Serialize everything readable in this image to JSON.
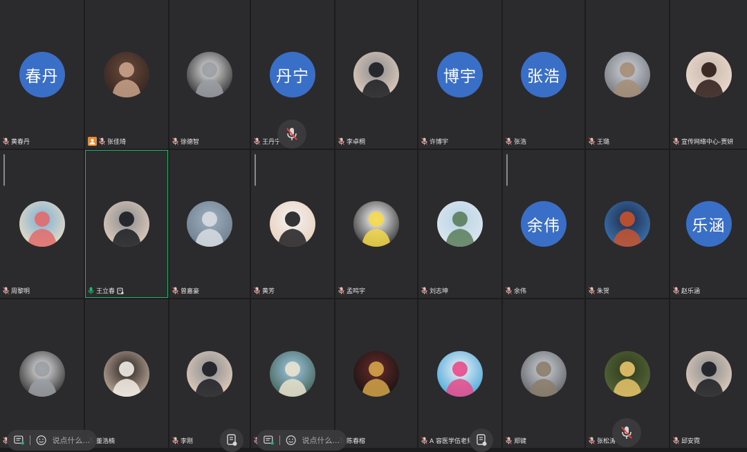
{
  "colors": {
    "tile_bg": "#2b2b2d",
    "avatar_blue": "#3a6fc8",
    "active_border": "#23b26d",
    "host_badge": "#f08a24"
  },
  "participants": [
    {
      "name": "黄春丹",
      "avatar_text": "春丹",
      "avatar_type": "text",
      "mic": "muted"
    },
    {
      "name": "张佳琦",
      "avatar_type": "photo",
      "photo_hint": "girl-portrait",
      "mic": "muted",
      "host": true
    },
    {
      "name": "徐德智",
      "avatar_type": "photo",
      "photo_hint": "boy-portrait",
      "mic": "muted"
    },
    {
      "name": "王丹宁",
      "avatar_text": "丹宁",
      "avatar_type": "text",
      "mic": "muted"
    },
    {
      "name": "李卓桐",
      "avatar_type": "photo",
      "photo_hint": "man-suit",
      "mic": "muted"
    },
    {
      "name": "许博宇",
      "avatar_text": "博宇",
      "avatar_type": "text",
      "mic": "muted"
    },
    {
      "name": "张浩",
      "avatar_text": "张浩",
      "avatar_type": "text",
      "mic": "muted"
    },
    {
      "name": "王璐",
      "avatar_type": "photo",
      "photo_hint": "cat",
      "mic": "muted"
    },
    {
      "name": "宣传网络中心-贾妍",
      "avatar_type": "photo",
      "photo_hint": "woman-portrait",
      "mic": "muted"
    },
    {
      "name": "周黎明",
      "avatar_type": "photo",
      "photo_hint": "cartoon",
      "mic": "muted"
    },
    {
      "name": "王立春",
      "avatar_type": "photo",
      "photo_hint": "man-suit",
      "mic": "speaking",
      "sharing": true,
      "active": true
    },
    {
      "name": "曾嘉豪",
      "avatar_type": "photo",
      "photo_hint": "toy",
      "mic": "muted"
    },
    {
      "name": "黄芳",
      "avatar_type": "photo",
      "photo_hint": "woman-suit",
      "mic": "muted"
    },
    {
      "name": "孟鸣宇",
      "avatar_type": "photo",
      "photo_hint": "illustration-girl",
      "mic": "muted"
    },
    {
      "name": "刘志坤",
      "avatar_type": "photo",
      "photo_hint": "landscape",
      "mic": "muted"
    },
    {
      "name": "余伟",
      "avatar_text": "余伟",
      "avatar_type": "text",
      "mic": "muted"
    },
    {
      "name": "朱贺",
      "avatar_type": "photo",
      "photo_hint": "fox-cartoon",
      "mic": "muted"
    },
    {
      "name": "赵乐涵",
      "avatar_text": "乐涵",
      "avatar_type": "text",
      "mic": "muted"
    },
    {
      "name": "",
      "avatar_type": "photo",
      "photo_hint": "boy-portrait",
      "mic": "muted"
    },
    {
      "name": "董浩楠",
      "avatar_type": "photo",
      "photo_hint": "puppies",
      "mic": "muted"
    },
    {
      "name": "李刚",
      "avatar_type": "photo",
      "photo_hint": "man-suit",
      "mic": "muted"
    },
    {
      "name": "",
      "avatar_type": "photo",
      "photo_hint": "beach",
      "mic": "muted"
    },
    {
      "name": "陈春榕",
      "avatar_type": "photo",
      "photo_hint": "woman-dress",
      "mic": "muted"
    },
    {
      "name": "A 容医学伍老师",
      "avatar_type": "photo",
      "photo_hint": "logo-poster",
      "mic": "muted"
    },
    {
      "name": "郑键",
      "avatar_type": "photo",
      "photo_hint": "building",
      "mic": "muted"
    },
    {
      "name": "张松涛",
      "avatar_type": "photo",
      "photo_hint": "forest",
      "mic": "muted"
    },
    {
      "name": "邱安霓",
      "avatar_type": "photo",
      "photo_hint": "man-suit",
      "mic": "muted"
    }
  ],
  "chat": {
    "placeholder": "说点什么..."
  }
}
